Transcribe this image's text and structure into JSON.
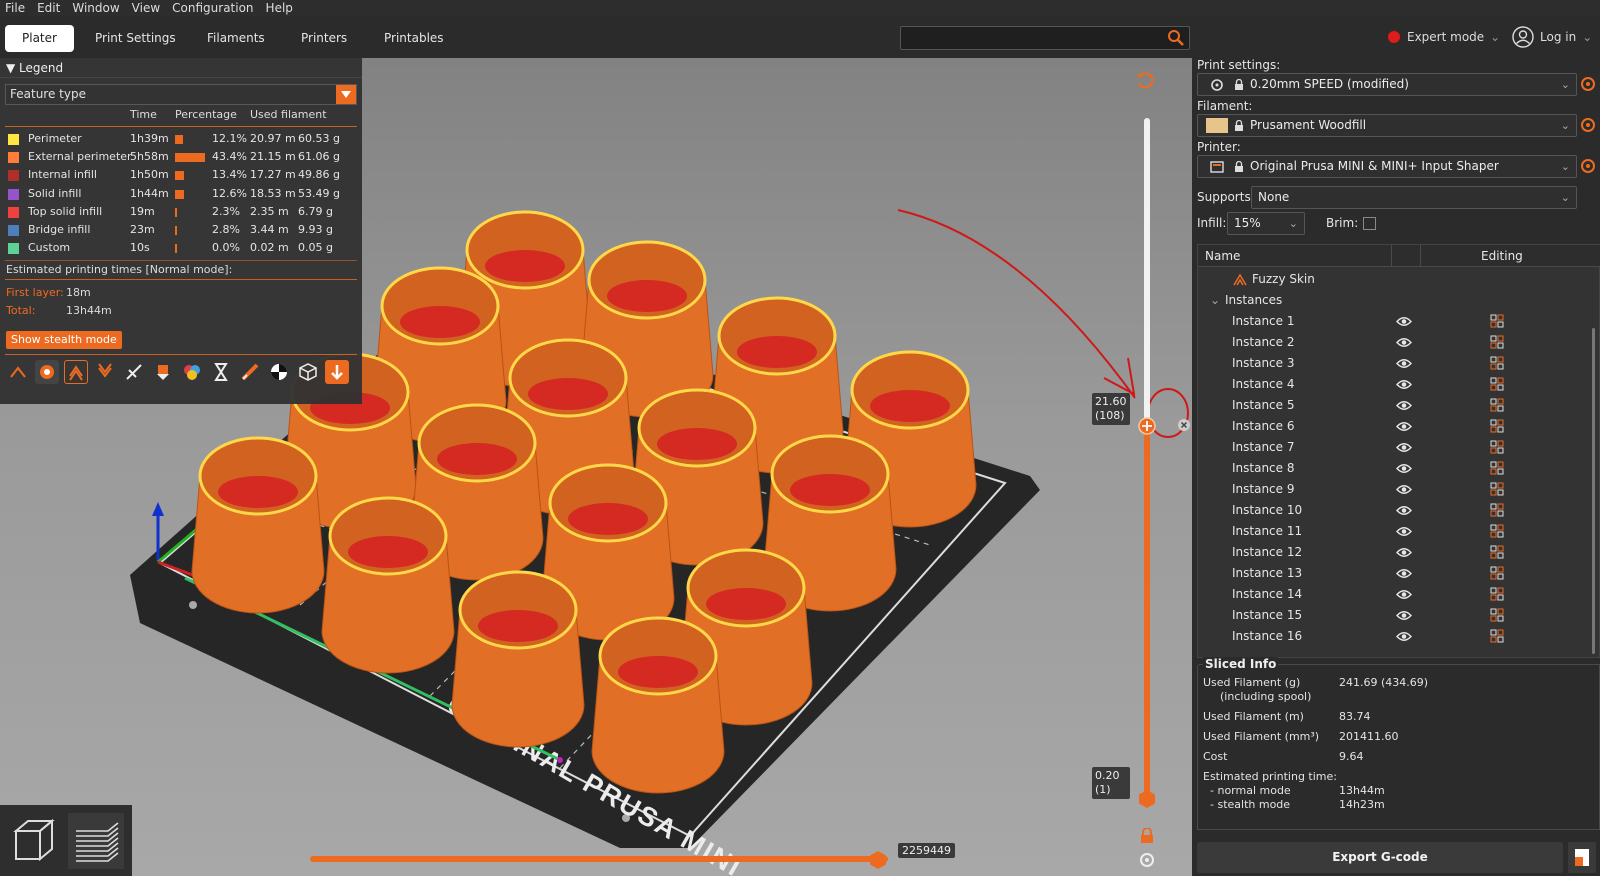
{
  "menu": [
    "File",
    "Edit",
    "Window",
    "View",
    "Configuration",
    "Help"
  ],
  "tabs": [
    "Plater",
    "Print Settings",
    "Filaments",
    "Printers",
    "Printables"
  ],
  "search": {
    "placeholder": ""
  },
  "header": {
    "mode_label": "Expert mode",
    "login_label": "Log in"
  },
  "legend": {
    "title": "Legend",
    "view_type": "Feature type",
    "columns": [
      "Time",
      "Percentage",
      "Used filament"
    ],
    "rows": [
      {
        "name": "Perimeter",
        "time": "1h39m",
        "pct": "12.1%",
        "length": "20.97 m",
        "weight": "60.53 g",
        "color": "#ffe640",
        "pct_value": 0.121
      },
      {
        "name": "External perimeter",
        "time": "5h58m",
        "pct": "43.4%",
        "length": "21.15 m",
        "weight": "61.06 g",
        "color": "#ff7d38",
        "pct_value": 0.434
      },
      {
        "name": "Internal infill",
        "time": "1h50m",
        "pct": "13.4%",
        "length": "17.27 m",
        "weight": "49.86 g",
        "color": "#b03029",
        "pct_value": 0.134
      },
      {
        "name": "Solid infill",
        "time": "1h44m",
        "pct": "12.6%",
        "length": "18.53 m",
        "weight": "53.49 g",
        "color": "#9654cc",
        "pct_value": 0.126
      },
      {
        "name": "Top solid infill",
        "time": "19m",
        "pct": "2.3%",
        "length": "2.35 m",
        "weight": "6.79 g",
        "color": "#f04040",
        "pct_value": 0.023
      },
      {
        "name": "Bridge infill",
        "time": "23m",
        "pct": "2.8%",
        "length": "3.44 m",
        "weight": "9.93 g",
        "color": "#4d80ba",
        "pct_value": 0.028
      },
      {
        "name": "Custom",
        "time": "10s",
        "pct": "0.0%",
        "length": "0.02 m",
        "weight": "0.05 g",
        "color": "#5ed194",
        "pct_value": 0.0
      }
    ],
    "estimated_title": "Estimated printing times [Normal mode]:",
    "first_layer_label": "First layer:",
    "first_layer_value": "18m",
    "total_label": "Total:",
    "total_value": "13h44m",
    "stealth_button": "Show stealth mode"
  },
  "slider": {
    "top_value": "21.60",
    "top_layer": "(108)",
    "bottom_value": "0.20",
    "bottom_layer": "(1)",
    "horizontal_value": "2259449"
  },
  "bed_text": "ORIGINAL PRUSA MINI",
  "sidebar": {
    "print_settings_label": "Print settings:",
    "print_settings_value": "0.20mm SPEED (modified)",
    "filament_label": "Filament:",
    "filament_value": "Prusament Woodfill",
    "filament_color": "#e6c48a",
    "printer_label": "Printer:",
    "printer_value": "Original Prusa MINI & MINI+ Input Shaper",
    "supports_label": "Supports:",
    "supports_value": "None",
    "infill_label": "Infill:",
    "infill_value": "15%",
    "brim_label": "Brim:"
  },
  "objects": {
    "col_name": "Name",
    "col_editing": "Editing",
    "modifier": "Fuzzy Skin",
    "instances_label": "Instances",
    "instances": [
      "Instance 1",
      "Instance 2",
      "Instance 3",
      "Instance 4",
      "Instance 5",
      "Instance 6",
      "Instance 7",
      "Instance 8",
      "Instance 9",
      "Instance 10",
      "Instance 11",
      "Instance 12",
      "Instance 13",
      "Instance 14",
      "Instance 15",
      "Instance 16"
    ]
  },
  "sliced_info": {
    "title": "Sliced Info",
    "used_g_label": "Used Filament (g)",
    "used_g_sub": "(including spool)",
    "used_g_value": "241.69 (434.69)",
    "used_m_label": "Used Filament (m)",
    "used_m_value": "83.74",
    "used_mm3_label": "Used Filament (mm³)",
    "used_mm3_value": "201411.60",
    "cost_label": "Cost",
    "cost_value": "9.64",
    "est_label": "Estimated printing time:",
    "normal_label": "- normal mode",
    "normal_value": "13h44m",
    "stealth_label": "- stealth mode",
    "stealth_value": "14h23m"
  },
  "export_button": "Export G-code"
}
